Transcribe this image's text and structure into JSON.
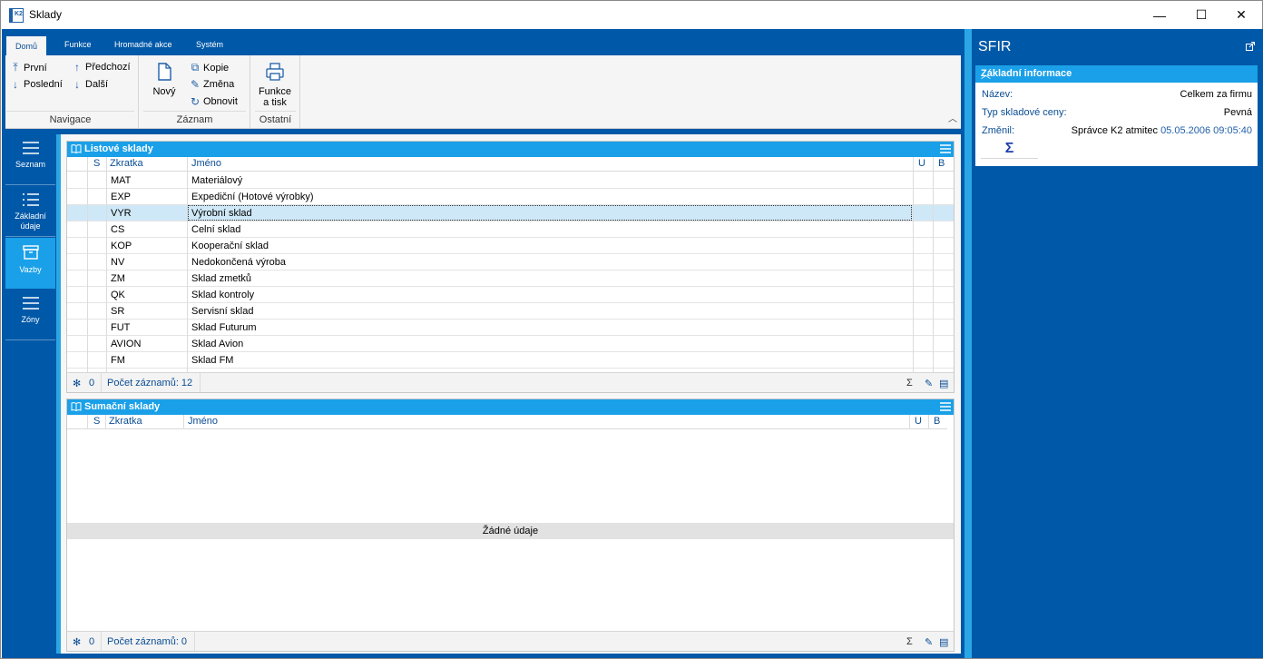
{
  "window": {
    "title": "Sklady",
    "controls": {
      "minimize": "—",
      "maximize": "☐",
      "close": "✕"
    }
  },
  "ribbon": {
    "tabs": [
      {
        "label": "Domů",
        "active": true
      },
      {
        "label": "Funkce"
      },
      {
        "label": "Hromadné akce"
      },
      {
        "label": "Systém"
      }
    ],
    "navigace": {
      "label": "Navigace",
      "prvni": "První",
      "posledni": "Poslední",
      "predchozi": "Předchozí",
      "dalsi": "Další"
    },
    "zaznam": {
      "label": "Záznam",
      "novy": "Nový",
      "kopie": "Kopie",
      "zmena": "Změna",
      "obnovit": "Obnovit"
    },
    "ostatni": {
      "label": "Ostatní",
      "funkce_line1": "Funkce",
      "funkce_line2": "a tisk"
    }
  },
  "leftnav": [
    {
      "label": "Seznam",
      "icon": "list-icon"
    },
    {
      "label_line1": "Základní",
      "label_line2": "údaje",
      "icon": "details-icon"
    },
    {
      "label": "Vazby",
      "icon": "box-icon",
      "active": true
    },
    {
      "label": "Zóny",
      "icon": "list-icon"
    }
  ],
  "listove": {
    "title": "Listové sklady",
    "columns": {
      "s": "S",
      "zkratka": "Zkratka",
      "jmeno": "Jméno",
      "u": "U",
      "b": "B"
    },
    "rows": [
      {
        "zkratka": "MAT",
        "jmeno": "Materiálový"
      },
      {
        "zkratka": "EXP",
        "jmeno": "Expediční (Hotové výrobky)"
      },
      {
        "zkratka": "VYR",
        "jmeno": "Výrobní sklad",
        "selected": true
      },
      {
        "zkratka": "CS",
        "jmeno": "Celní sklad"
      },
      {
        "zkratka": "KOP",
        "jmeno": "Kooperační sklad"
      },
      {
        "zkratka": "NV",
        "jmeno": "Nedokončená výroba"
      },
      {
        "zkratka": "ZM",
        "jmeno": "Sklad zmetků"
      },
      {
        "zkratka": "QK",
        "jmeno": "Sklad kontroly"
      },
      {
        "zkratka": "SR",
        "jmeno": "Servisní sklad"
      },
      {
        "zkratka": "FUT",
        "jmeno": "Sklad Futurum"
      },
      {
        "zkratka": "AVION",
        "jmeno": "Sklad Avion"
      },
      {
        "zkratka": "FM",
        "jmeno": "Sklad FM"
      }
    ],
    "footer": {
      "selected_count": "0",
      "count_text": "Počet záznamů: 12"
    }
  },
  "sumacni": {
    "title": "Sumační sklady",
    "columns": {
      "s": "S",
      "zkratka": "Zkratka",
      "jmeno": "Jméno",
      "u": "U",
      "b": "B"
    },
    "empty_text": "Žádné údaje",
    "footer": {
      "selected_count": "0",
      "count_text": "Počet záznamů: 0"
    }
  },
  "rightpane": {
    "title": "SFIR",
    "section": "Základní informace",
    "nazev_label": "Název:",
    "nazev_value": "Celkem za firmu",
    "typ_label": "Typ skladové ceny:",
    "typ_value": "Pevná",
    "zmenil_label": "Změnil:",
    "zmenil_user": "Správce K2 atmitec",
    "zmenil_date": "05.05.2006 09:05:40",
    "sigma": "Σ"
  },
  "colors": {
    "brand_blue": "#0058a8",
    "accent_cyan": "#1aa0e8",
    "selected_row": "#cfe8f8"
  }
}
